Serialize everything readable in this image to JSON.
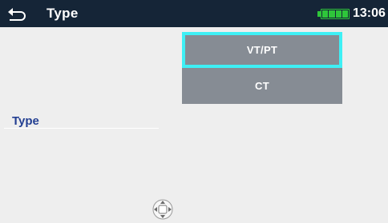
{
  "header": {
    "title": "Type",
    "time": "13:06"
  },
  "options": [
    "VT/PT",
    "CT"
  ],
  "selected_option": "VT/PT",
  "parameter": {
    "label": "Type"
  },
  "colors": {
    "topbar": "#152537",
    "option_bg": "#868c94",
    "selection_border": "#3ef0f5",
    "label": "#233f92",
    "battery": "#2ec63a"
  },
  "icons": {
    "back": "back-arrow-icon",
    "battery": "battery-icon",
    "navigation": "dpad-navigation-icon"
  }
}
